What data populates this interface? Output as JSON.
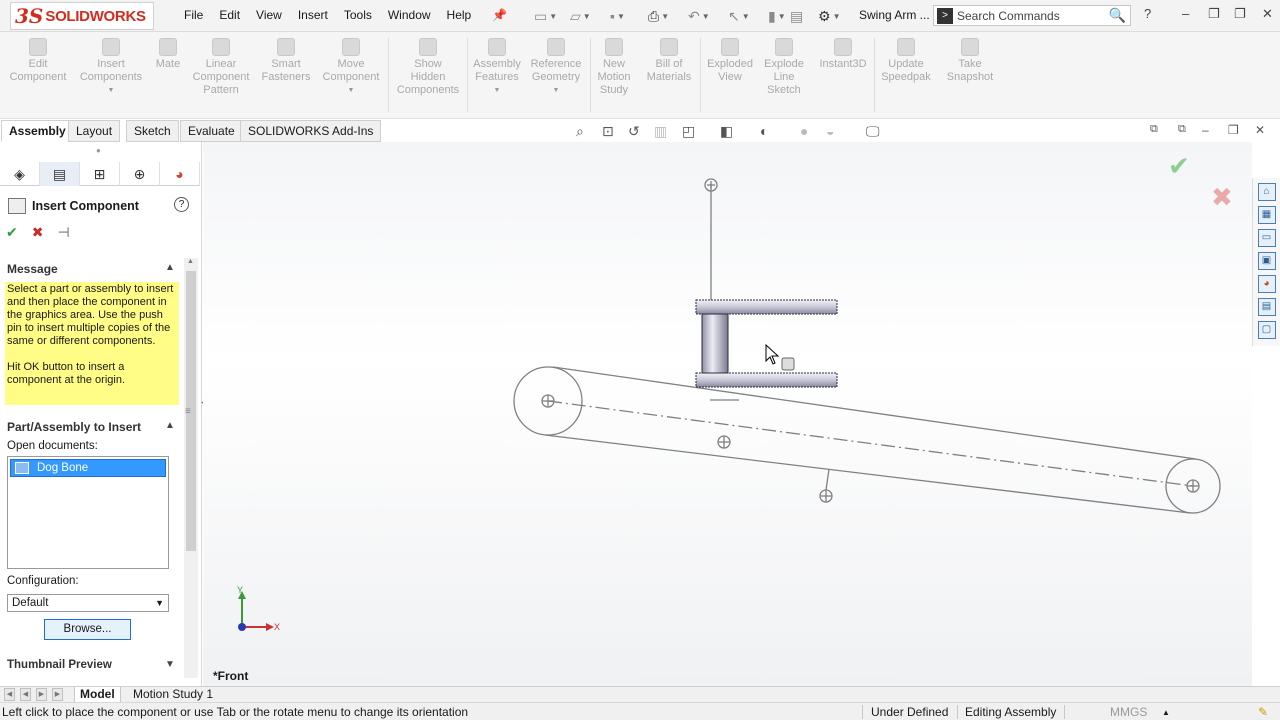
{
  "app": {
    "logo_mark": "3S",
    "brand": "SOLIDWORKS",
    "doc_title": "Swing Arm ..."
  },
  "menu": [
    "File",
    "Edit",
    "View",
    "Insert",
    "Tools",
    "Window",
    "Help"
  ],
  "search": {
    "placeholder": "Search Commands"
  },
  "window_controls": {
    "help": "?",
    "minimize": "–",
    "restore": "❐",
    "maximize": "□"
  },
  "commands": [
    {
      "label": "Edit\nComponent"
    },
    {
      "label": "Insert\nComponents"
    },
    {
      "label": "Mate"
    },
    {
      "label": "Linear\nComponent\nPattern"
    },
    {
      "label": "Smart\nFasteners"
    },
    {
      "label": "Move\nComponent"
    },
    {
      "label": "Show\nHidden\nComponents"
    },
    {
      "label": "Assembly\nFeatures"
    },
    {
      "label": "Reference\nGeometry"
    },
    {
      "label": "New\nMotion\nStudy"
    },
    {
      "label": "Bill of\nMaterials"
    },
    {
      "label": "Exploded\nView"
    },
    {
      "label": "Explode\nLine\nSketch"
    },
    {
      "label": "Instant3D"
    },
    {
      "label": "Update\nSpeedpak"
    },
    {
      "label": "Take\nSnapshot"
    }
  ],
  "tabs": [
    "Assembly",
    "Layout",
    "Sketch",
    "Evaluate",
    "SOLIDWORKS Add-Ins"
  ],
  "property_manager": {
    "title": "Insert Component",
    "help": "?",
    "message_header": "Message",
    "message_p1": "Select a part or assembly to insert and then place the component in the graphics area. Use the push pin to insert multiple copies of the same or different components.",
    "message_p2": "Hit OK button to insert a component at the origin.",
    "part_header": "Part/Assembly to Insert",
    "open_docs_label": "Open documents:",
    "open_docs": [
      "Dog Bone"
    ],
    "config_label": "Configuration:",
    "config_value": "Default",
    "browse_label": "Browse...",
    "thumb_header": "Thumbnail Preview"
  },
  "graphics": {
    "view_label": "*Front",
    "axis_x": "X",
    "axis_y": "Y"
  },
  "bottom_tabs": [
    "Model",
    "Motion Study 1"
  ],
  "status": {
    "hint": "Left click to place the component or use Tab or the rotate menu to change its orientation",
    "state": "Under Defined",
    "mode": "Editing Assembly",
    "units": "MMGS"
  },
  "colors": {
    "accent": "#3399ff",
    "brand": "#d52b1e",
    "message_bg": "#fffd85",
    "ok": "#2e9d3a",
    "cancel": "#cc2b2b"
  }
}
